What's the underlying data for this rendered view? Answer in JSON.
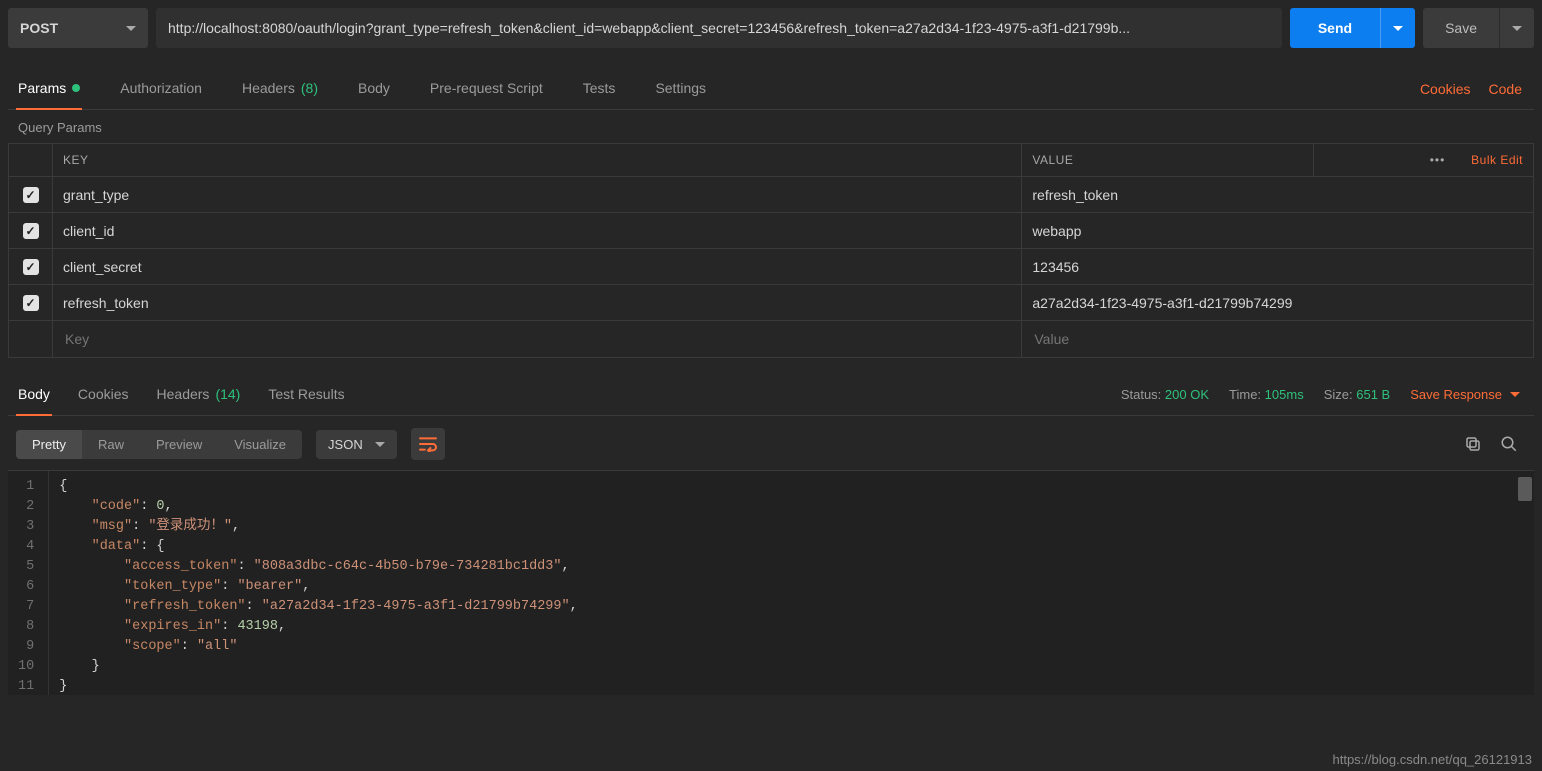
{
  "request": {
    "method": "POST",
    "url": "http://localhost:8080/oauth/login?grant_type=refresh_token&client_id=webapp&client_secret=123456&refresh_token=a27a2d34-1f23-4975-a3f1-d21799b...",
    "send_label": "Send",
    "save_label": "Save"
  },
  "tabs": {
    "params": "Params",
    "authorization": "Authorization",
    "headers": "Headers",
    "headers_count": "(8)",
    "body": "Body",
    "prerequest": "Pre-request Script",
    "tests": "Tests",
    "settings": "Settings",
    "cookies_link": "Cookies",
    "code_link": "Code"
  },
  "params_section": {
    "title": "Query Params",
    "key_header": "KEY",
    "value_header": "VALUE",
    "bulk_edit": "Bulk Edit",
    "key_placeholder": "Key",
    "value_placeholder": "Value",
    "rows": [
      {
        "enabled": true,
        "key": "grant_type",
        "value": "refresh_token"
      },
      {
        "enabled": true,
        "key": "client_id",
        "value": "webapp"
      },
      {
        "enabled": true,
        "key": "client_secret",
        "value": "123456"
      },
      {
        "enabled": true,
        "key": "refresh_token",
        "value": "a27a2d34-1f23-4975-a3f1-d21799b74299"
      }
    ]
  },
  "response_tabs": {
    "body": "Body",
    "cookies": "Cookies",
    "headers": "Headers",
    "headers_count": "(14)",
    "test_results": "Test Results"
  },
  "response_meta": {
    "status_label": "Status:",
    "status_value": "200 OK",
    "time_label": "Time:",
    "time_value": "105ms",
    "size_label": "Size:",
    "size_value": "651 B",
    "save_response": "Save Response"
  },
  "body_view": {
    "pretty": "Pretty",
    "raw": "Raw",
    "preview": "Preview",
    "visualize": "Visualize",
    "format": "JSON"
  },
  "json_lines": [
    {
      "num": "1",
      "html": "<span class='p'>{</span>"
    },
    {
      "num": "2",
      "html": "    <span class='k'>\"code\"</span><span class='p'>: </span><span class='n'>0</span><span class='p'>,</span>"
    },
    {
      "num": "3",
      "html": "    <span class='k'>\"msg\"</span><span class='p'>: </span><span class='s'>\"登录成功！\"</span><span class='p'>,</span>"
    },
    {
      "num": "4",
      "html": "    <span class='k'>\"data\"</span><span class='p'>: {</span>"
    },
    {
      "num": "5",
      "html": "        <span class='k'>\"access_token\"</span><span class='p'>: </span><span class='s'>\"808a3dbc-c64c-4b50-b79e-734281bc1dd3\"</span><span class='p'>,</span>"
    },
    {
      "num": "6",
      "html": "        <span class='k'>\"token_type\"</span><span class='p'>: </span><span class='s'>\"bearer\"</span><span class='p'>,</span>"
    },
    {
      "num": "7",
      "html": "        <span class='k'>\"refresh_token\"</span><span class='p'>: </span><span class='s'>\"a27a2d34-1f23-4975-a3f1-d21799b74299\"</span><span class='p'>,</span>"
    },
    {
      "num": "8",
      "html": "        <span class='k'>\"expires_in\"</span><span class='p'>: </span><span class='n'>43198</span><span class='p'>,</span>"
    },
    {
      "num": "9",
      "html": "        <span class='k'>\"scope\"</span><span class='p'>: </span><span class='s'>\"all\"</span>"
    },
    {
      "num": "10",
      "html": "    <span class='p'>}</span>"
    },
    {
      "num": "11",
      "html": "<span class='p'>}</span>"
    }
  ],
  "watermark": "https://blog.csdn.net/qq_26121913"
}
